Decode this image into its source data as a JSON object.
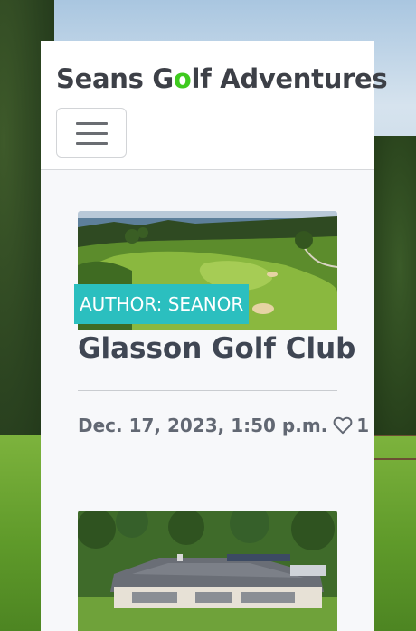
{
  "brand": {
    "prefix": "Seans G",
    "accent_letter": "o",
    "suffix": "lf Adventures",
    "accent_color": "#3fca1f"
  },
  "navbar": {
    "toggler_icon": "hamburger-menu-icon"
  },
  "posts": [
    {
      "author_badge": "AUTHOR: SEANOR",
      "title": "Glasson Golf Club",
      "date": "Dec. 17, 2023, 1:50 p.m.",
      "likes": "1",
      "like_icon": "heart-outline-icon",
      "image": "aerial view of golf course by a lake"
    },
    {
      "image": "aerial view of golf clubhouse"
    }
  ],
  "colors": {
    "badge": "#2bbfbf",
    "panel": "#f7f8fa",
    "title": "#3f4653"
  }
}
